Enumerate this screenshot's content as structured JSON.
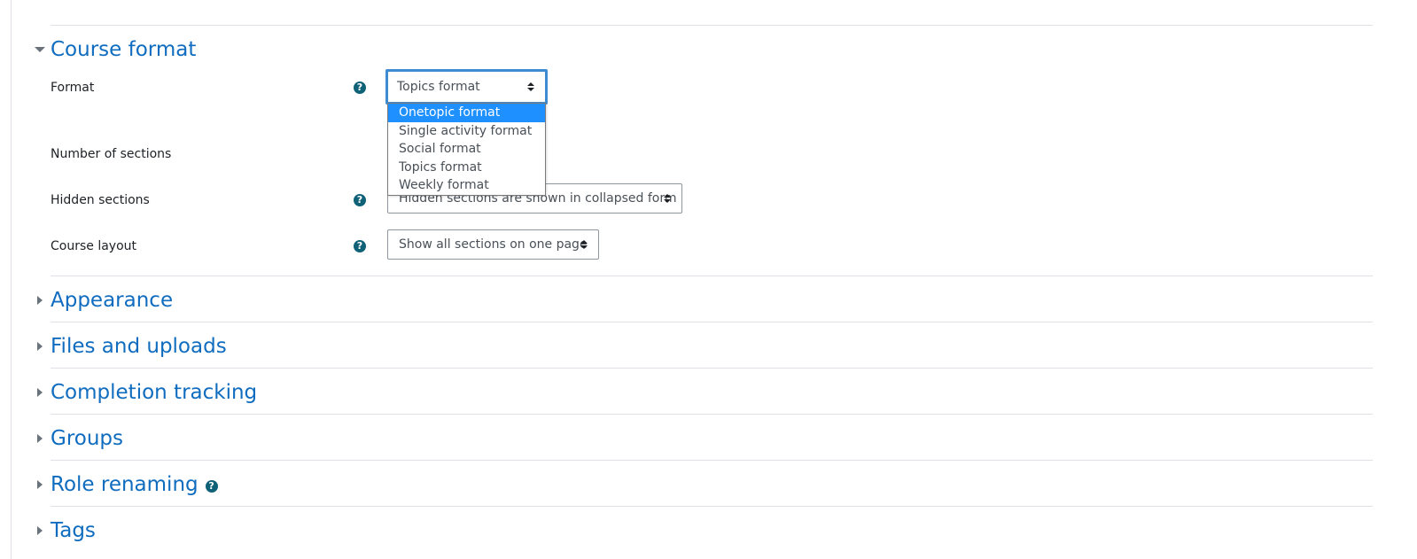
{
  "sections": {
    "course_format": {
      "title": "Course format",
      "expanded": true
    },
    "appearance": {
      "title": "Appearance"
    },
    "files_and_uploads": {
      "title": "Files and uploads"
    },
    "completion_tracking": {
      "title": "Completion tracking"
    },
    "groups": {
      "title": "Groups"
    },
    "role_renaming": {
      "title": "Role renaming"
    },
    "tags": {
      "title": "Tags"
    }
  },
  "fields": {
    "format": {
      "label": "Format",
      "value": "Topics format"
    },
    "number_of_sections": {
      "label": "Number of sections"
    },
    "hidden_sections": {
      "label": "Hidden sections",
      "value": "Hidden sections are shown in collapsed form"
    },
    "course_layout": {
      "label": "Course layout",
      "value": "Show all sections on one page"
    }
  },
  "format_dropdown": {
    "options": [
      "Onetopic format",
      "Single activity format",
      "Social format",
      "Topics format",
      "Weekly format"
    ],
    "highlighted": "Onetopic format"
  },
  "help_icon_glyph": "?",
  "colors": {
    "link": "#0f6cbf",
    "help_icon": "#0f6178",
    "focus_border": "#3d8bd0",
    "option_highlight": "#1e90ff"
  }
}
